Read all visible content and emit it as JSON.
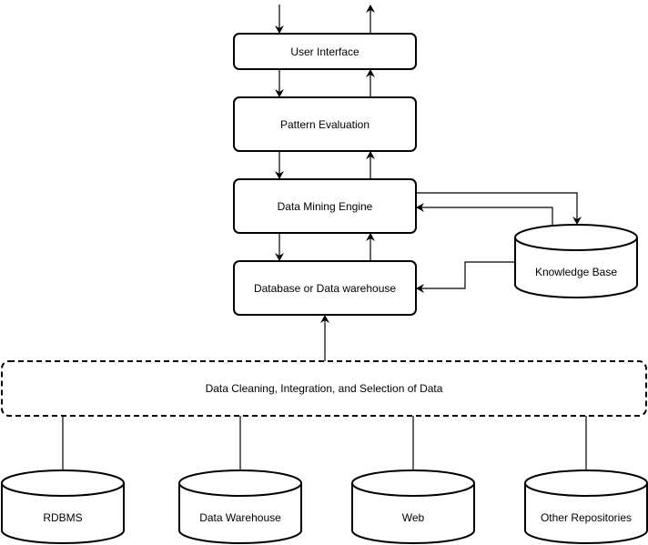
{
  "boxes": {
    "ui": "User Interface",
    "pe": "Pattern Evaluation",
    "dme": "Data Mining Engine",
    "db": "Database or Data warehouse",
    "clean": "Data Cleaning, Integration, and Selection of Data"
  },
  "stores": {
    "kb": "Knowledge Base",
    "rdbms": "RDBMS",
    "dw": "Data Warehouse",
    "web": "Web",
    "other": "Other Repositories"
  }
}
